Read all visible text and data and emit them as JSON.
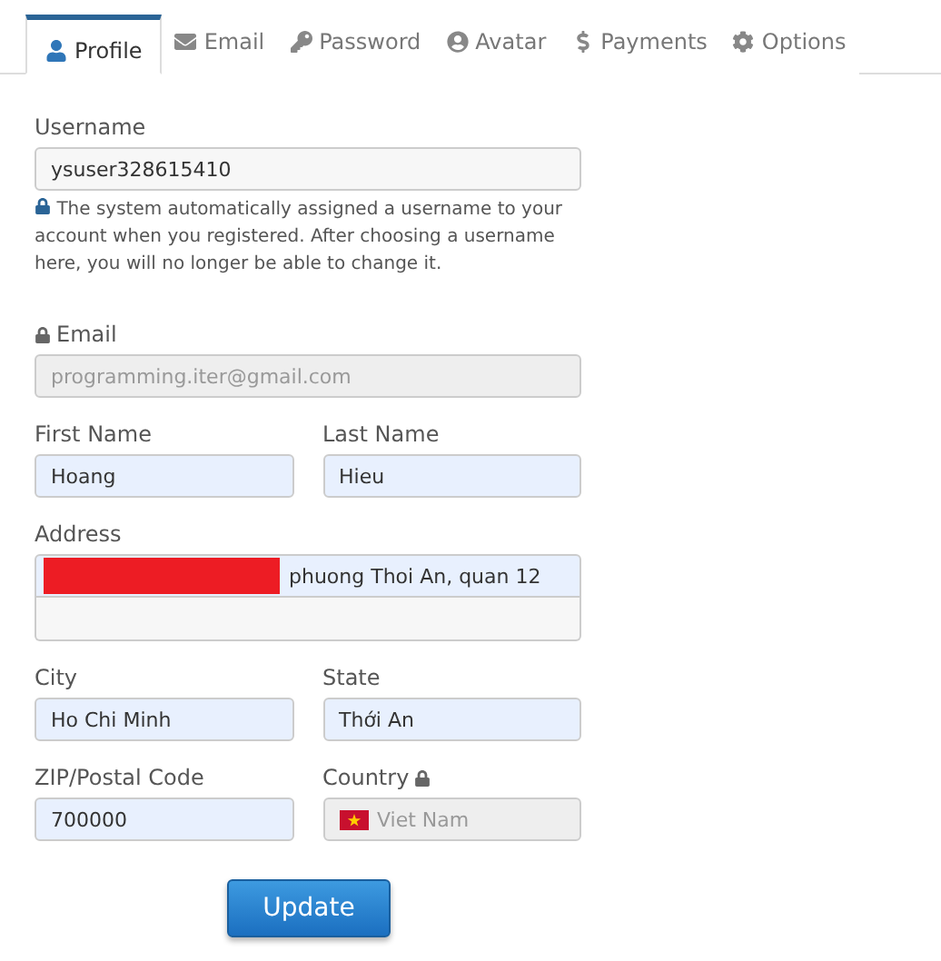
{
  "tabs": [
    {
      "label": "Profile",
      "selected": true
    },
    {
      "label": "Email",
      "selected": false
    },
    {
      "label": "Password",
      "selected": false
    },
    {
      "label": "Avatar",
      "selected": false
    },
    {
      "label": "Payments",
      "selected": false
    },
    {
      "label": "Options",
      "selected": false
    }
  ],
  "rows": [
    {
      "fields": [
        {
          "kind": "text",
          "label": "Username",
          "value": "ysuser328615410",
          "autofilled": false,
          "disabled": false,
          "help": "The system automatically assigned a username to your account when you registered. After choosing a username here, you will no longer be able to change it."
        }
      ]
    },
    {
      "fields": [
        {
          "kind": "text",
          "label": "Email",
          "value": "programming.iter@gmail.com",
          "disabled": true,
          "locked": true
        }
      ]
    },
    {
      "fields": [
        {
          "kind": "text",
          "label": "First Name",
          "value": "Hoang",
          "autofilled": true,
          "disabled": false
        },
        {
          "kind": "text",
          "label": "Last Name",
          "value": "Hieu",
          "autofilled": true,
          "disabled": false
        }
      ]
    },
    {
      "fields": [
        {
          "kind": "address",
          "label": "Address",
          "value": "phuong Thoi An, quan 12",
          "autofilled": true,
          "disabled": false,
          "redacted": true
        }
      ]
    },
    {
      "fields": [
        {
          "kind": "text",
          "label": "City",
          "value": "Ho Chi Minh",
          "autofilled": true,
          "disabled": false
        },
        {
          "kind": "text",
          "label": "State",
          "value": "Thới An",
          "autofilled": true,
          "disabled": false
        }
      ]
    },
    {
      "fields": [
        {
          "kind": "text",
          "label": "ZIP/Postal Code",
          "value": "700000",
          "autofilled": true,
          "disabled": false
        },
        {
          "kind": "country",
          "label": "Country",
          "value": "Viet Nam",
          "disabled": true,
          "locked": true
        }
      ]
    }
  ],
  "submit": "Update"
}
